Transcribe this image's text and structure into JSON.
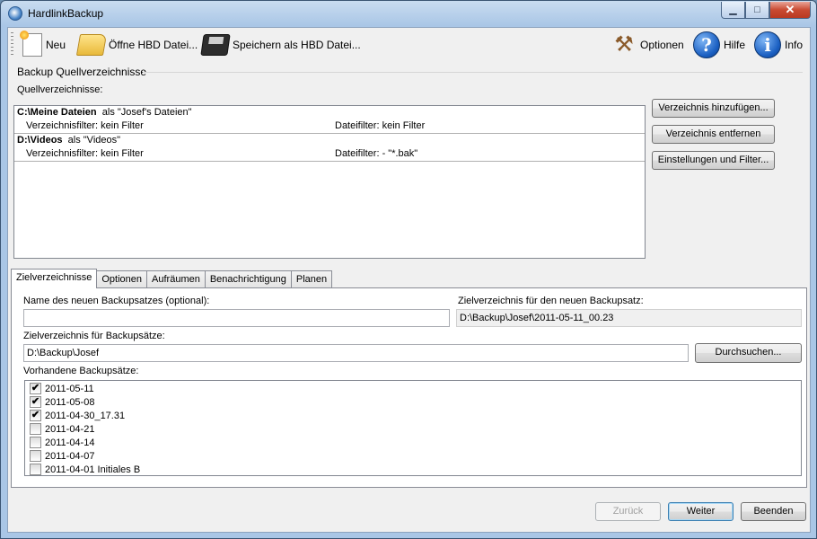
{
  "window": {
    "title": "HardlinkBackup"
  },
  "toolbar": {
    "new_label": "Neu",
    "open_label": "Öffne HBD Datei...",
    "save_label": "Speichern als HBD Datei...",
    "options_label": "Optionen",
    "help_label": "Hilfe",
    "info_label": "Info"
  },
  "source_group": {
    "title": "Backup Quellverzeichnisse",
    "list_label": "Quellverzeichnisse:",
    "items": [
      {
        "path": "C:\\Meine Dateien",
        "alias": "als \"Josef's Dateien\"",
        "dir_filter": "Verzeichnisfilter:   kein Filter",
        "file_filter": "Dateifilter:   kein Filter"
      },
      {
        "path": "D:\\Videos",
        "alias": "als \"Videos\"",
        "dir_filter": "Verzeichnisfilter:   kein Filter",
        "file_filter": "Dateifilter:   - \"*.bak\""
      }
    ],
    "add_button": "Verzeichnis hinzufügen...",
    "remove_button": "Verzeichnis entfernen",
    "settings_button": "Einstellungen und Filter..."
  },
  "tabs": [
    "Zielverzeichnisse",
    "Optionen",
    "Aufräumen",
    "Benachrichtigung",
    "Planen"
  ],
  "target": {
    "name_label": "Name des neuen Backupsatzes (optional):",
    "name_value": "",
    "dest_new_label": "Zielverzeichnis für den neuen Backupsatz:",
    "dest_new_value": "D:\\Backup\\Josef\\2011-05-11_00.23",
    "dest_label": "Zielverzeichnis für Backupsätze:",
    "dest_value": "D:\\Backup\\Josef",
    "browse_button": "Durchsuchen...",
    "existing_label": "Vorhandene Backupsätze:",
    "sets": [
      {
        "name": "2011-05-11",
        "checked": true
      },
      {
        "name": "2011-05-08",
        "checked": true
      },
      {
        "name": "2011-04-30_17.31",
        "checked": true
      },
      {
        "name": "2011-04-21",
        "checked": false
      },
      {
        "name": "2011-04-14",
        "checked": false
      },
      {
        "name": "2011-04-07",
        "checked": false
      },
      {
        "name": "2011-04-01 Initiales B",
        "checked": false
      }
    ]
  },
  "footer": {
    "back": "Zurück",
    "next": "Weiter",
    "quit": "Beenden"
  },
  "colors": {
    "titlebar": "#a9c6e6",
    "client": "#f0f0f0",
    "close": "#c94a32",
    "default_border": "#3c7fb1"
  }
}
